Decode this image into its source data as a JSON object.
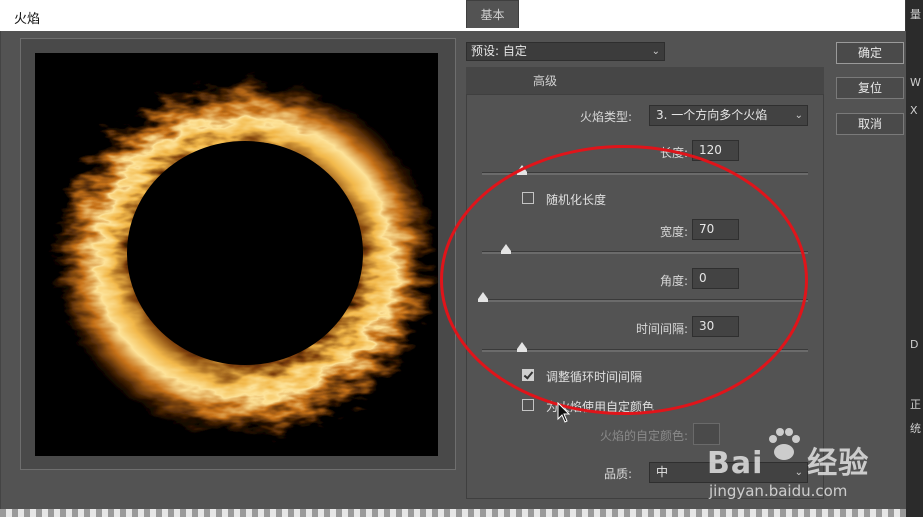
{
  "window": {
    "title": "火焰"
  },
  "right_strip": [
    "量",
    "W",
    "X",
    "D",
    "正",
    "统"
  ],
  "preset": {
    "label": "预设:",
    "value": "自定"
  },
  "tabs": [
    "基本",
    "高级"
  ],
  "fields": {
    "flame_type": {
      "label": "火焰类型:",
      "value": "3. 一个方向多个火焰"
    },
    "length": {
      "label": "长度:",
      "value": "120",
      "slider": 0.12
    },
    "randomize_length": {
      "label": "随机化长度",
      "checked": false
    },
    "width": {
      "label": "宽度:",
      "value": "70",
      "slider": 0.07
    },
    "angle": {
      "label": "角度:",
      "value": "0",
      "slider": 0.0
    },
    "interval": {
      "label": "时间间隔:",
      "value": "30",
      "slider": 0.12
    },
    "adjust_loop": {
      "label": "调整循环时间间隔",
      "checked": true
    },
    "custom_color": {
      "label": "为火焰使用自定颜色",
      "checked": false
    },
    "custom_color_value": {
      "label": "火焰的自定颜色:"
    },
    "quality": {
      "label": "品质:",
      "value": "中"
    }
  },
  "buttons": {
    "ok": "确定",
    "reset": "复位",
    "cancel": "取消"
  },
  "watermark": {
    "brand": "Bai",
    "brand2": "经验",
    "url": "jingyan.baidu.com"
  },
  "colors": {
    "annotation": "#e0141a",
    "panel": "#535353",
    "flame": "#f2b84a"
  }
}
